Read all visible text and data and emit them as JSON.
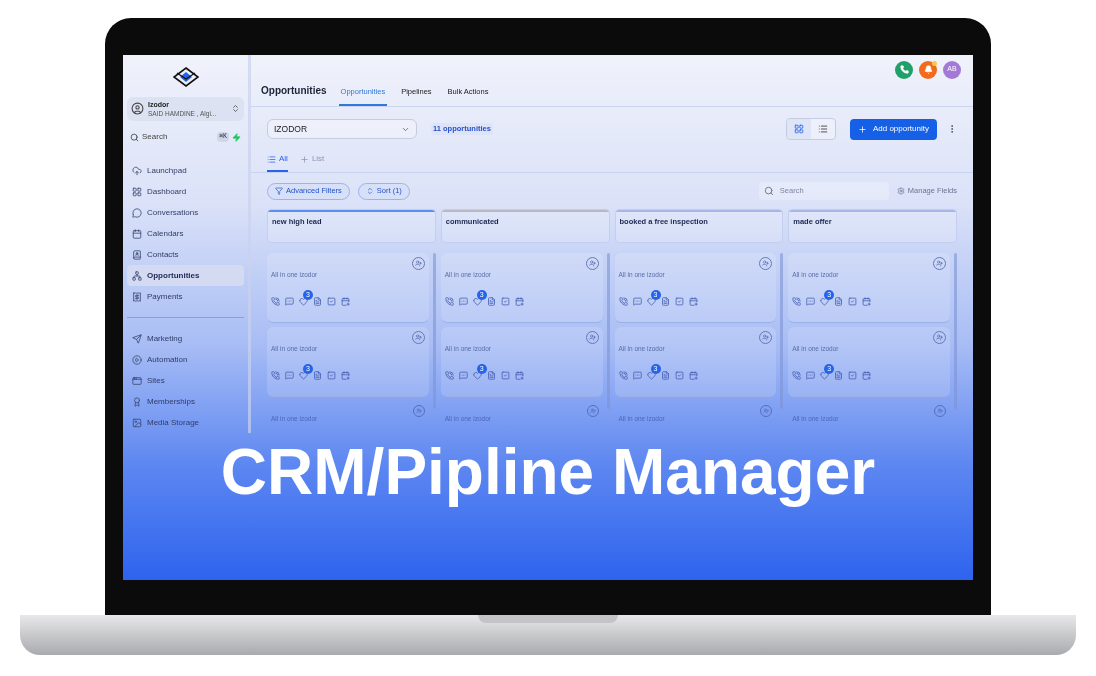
{
  "account": {
    "name": "Izodor",
    "subtitle": "SAID HAMDINE , Algi..."
  },
  "sidebar_search": {
    "placeholder": "Search",
    "shortcut": "⌘K"
  },
  "nav_groups": [
    {
      "items": [
        {
          "label": "Launchpad",
          "selected": false
        },
        {
          "label": "Dashboard",
          "selected": false
        },
        {
          "label": "Conversations",
          "selected": false
        },
        {
          "label": "Calendars",
          "selected": false
        },
        {
          "label": "Contacts",
          "selected": false
        },
        {
          "label": "Opportunities",
          "selected": true
        },
        {
          "label": "Payments",
          "selected": false
        }
      ]
    },
    {
      "items": [
        {
          "label": "Marketing",
          "selected": false
        },
        {
          "label": "Automation",
          "selected": false
        },
        {
          "label": "Sites",
          "selected": false
        },
        {
          "label": "Memberships",
          "selected": false
        },
        {
          "label": "Media Storage",
          "selected": false
        }
      ]
    }
  ],
  "top_bar": {
    "avatar": "AB",
    "notifications_unread": true
  },
  "header": {
    "title": "Opportunities",
    "tabs": [
      {
        "label": "Opportunities",
        "selected": true
      },
      {
        "label": "Pipelines",
        "selected": false
      },
      {
        "label": "Bulk Actions",
        "selected": false
      }
    ]
  },
  "toolbar": {
    "pipeline": "IZODOR",
    "count": "11 opportunities",
    "views": [
      {
        "kind": "grid",
        "selected": true
      },
      {
        "kind": "list",
        "selected": false
      }
    ],
    "add_button": "Add opportunity"
  },
  "view_tabs": [
    {
      "kind": "view",
      "label": "All",
      "selected": true
    },
    {
      "kind": "add",
      "label": "List",
      "selected": false
    }
  ],
  "filters": [
    {
      "kind": "filter",
      "label": "Advanced Filters"
    },
    {
      "kind": "sort",
      "label": "Sort (1)"
    }
  ],
  "board_search": {
    "placeholder": "Search"
  },
  "manage_fields": "Manage Fields",
  "columns": [
    {
      "title": "new high lead",
      "color": "#5b8ff0",
      "cards": [
        {
          "kind": "full",
          "title": "All in one izodor",
          "badge": "3"
        },
        {
          "kind": "full",
          "title": "All in one izodor",
          "badge": "3"
        },
        {
          "kind": "partial",
          "title": "All in one izodor"
        }
      ]
    },
    {
      "title": "communicated",
      "color": "#b9b8c0",
      "cards": [
        {
          "kind": "full",
          "title": "All in one izodor",
          "badge": "3"
        },
        {
          "kind": "full",
          "title": "All in one izodor",
          "badge": "3"
        },
        {
          "kind": "partial",
          "title": "All in one izodor"
        }
      ]
    },
    {
      "title": "booked a free inspection",
      "color": "#a7b6e6",
      "cards": [
        {
          "kind": "full",
          "title": "All in one izodor",
          "badge": "3"
        },
        {
          "kind": "full",
          "title": "All in one izodor",
          "badge": "3"
        },
        {
          "kind": "partial",
          "title": "All in one izodor"
        }
      ]
    },
    {
      "title": "made offer",
      "color": "#a7b6e6",
      "cards": [
        {
          "kind": "full",
          "title": "All in one izodor",
          "badge": "3"
        },
        {
          "kind": "full",
          "title": "All in one izodor",
          "badge": "3"
        },
        {
          "kind": "partial",
          "title": "All in one izodor"
        }
      ]
    }
  ],
  "banner": "CRM/Pipline Manager"
}
